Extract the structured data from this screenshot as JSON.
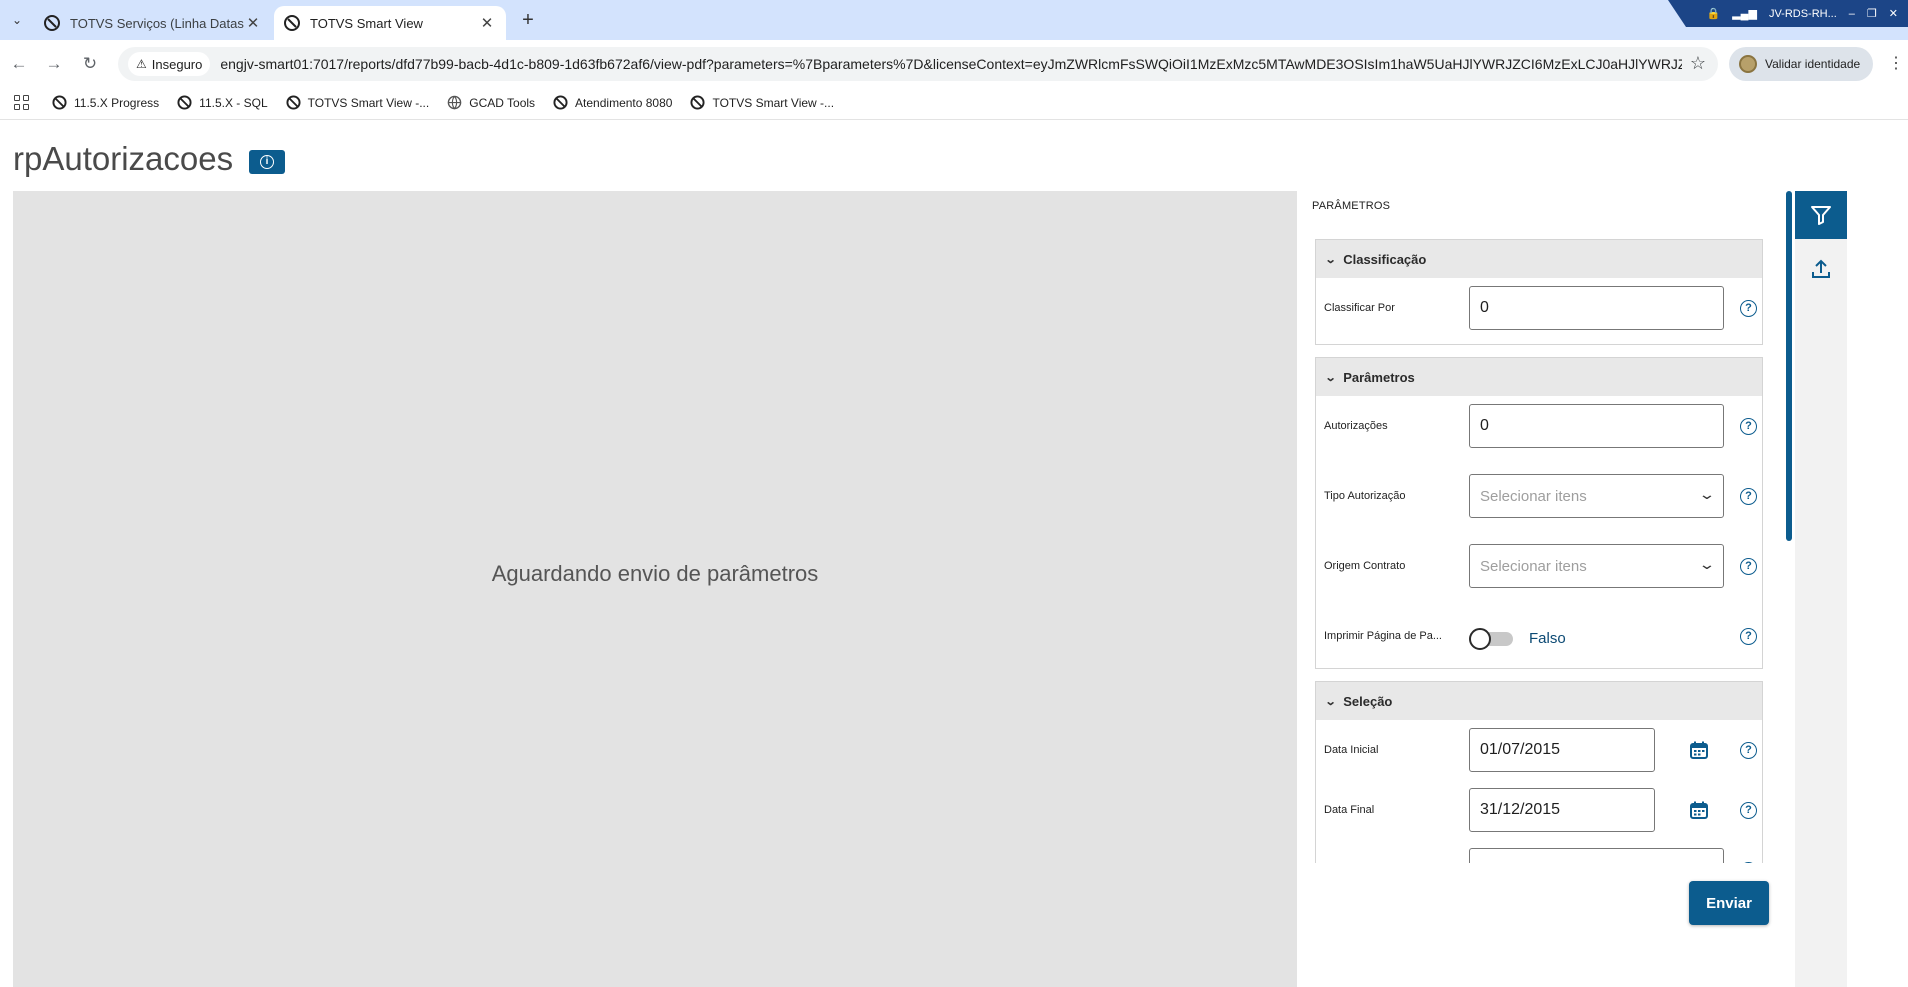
{
  "browser": {
    "tabs": [
      {
        "title": "TOTVS Serviços (Linha Datasul)",
        "active": false
      },
      {
        "title": "TOTVS Smart View",
        "active": true
      }
    ],
    "window_label": "JV-RDS-RH...",
    "insecure_label": "Inseguro",
    "url": "engjv-smart01:7017/reports/dfd77b99-bacb-4d1c-b809-1d63fb672af6/view-pdf?parameters=%7Bparameters%7D&licenseContext=eyJmZWRlcmFsSWQiOiI1MzExMzc5MTAwMDE3OSIsIm1haW5UaHJlYWRJZCI6MzExLCJ0aHJlYWRJZCI6...",
    "profile_label": "Validar identidade",
    "bookmarks": [
      "11.5.X Progress",
      "11.5.X - SQL",
      "TOTVS Smart View -...",
      "GCAD Tools",
      "Atendimento 8080",
      "TOTVS Smart View -..."
    ]
  },
  "page": {
    "title": "rpAutorizacoes",
    "waiting_message": "Aguardando envio de parâmetros"
  },
  "panel": {
    "title": "PARÂMETROS",
    "sections": {
      "classificacao": {
        "title": "Classificação",
        "classificar_por": {
          "label": "Classificar Por",
          "value": "0"
        }
      },
      "parametros": {
        "title": "Parâmetros",
        "autorizacoes": {
          "label": "Autorizações",
          "value": "0"
        },
        "tipo_autorizacao": {
          "label": "Tipo Autorização",
          "placeholder": "Selecionar itens"
        },
        "origem_contrato": {
          "label": "Origem Contrato",
          "placeholder": "Selecionar itens"
        },
        "imprimir_pagina": {
          "label": "Imprimir Página de Pa...",
          "value": "Falso"
        }
      },
      "selecao": {
        "title": "Seleção",
        "data_inicial": {
          "label": "Data Inicial",
          "value": "01/07/2015"
        },
        "data_final": {
          "label": "Data Final",
          "value": "31/12/2015"
        }
      }
    },
    "submit_label": "Enviar"
  },
  "colors": {
    "primary": "#0c5c8e",
    "tab_strip": "#d3e3fd",
    "preview_bg": "#e3e3e3"
  }
}
